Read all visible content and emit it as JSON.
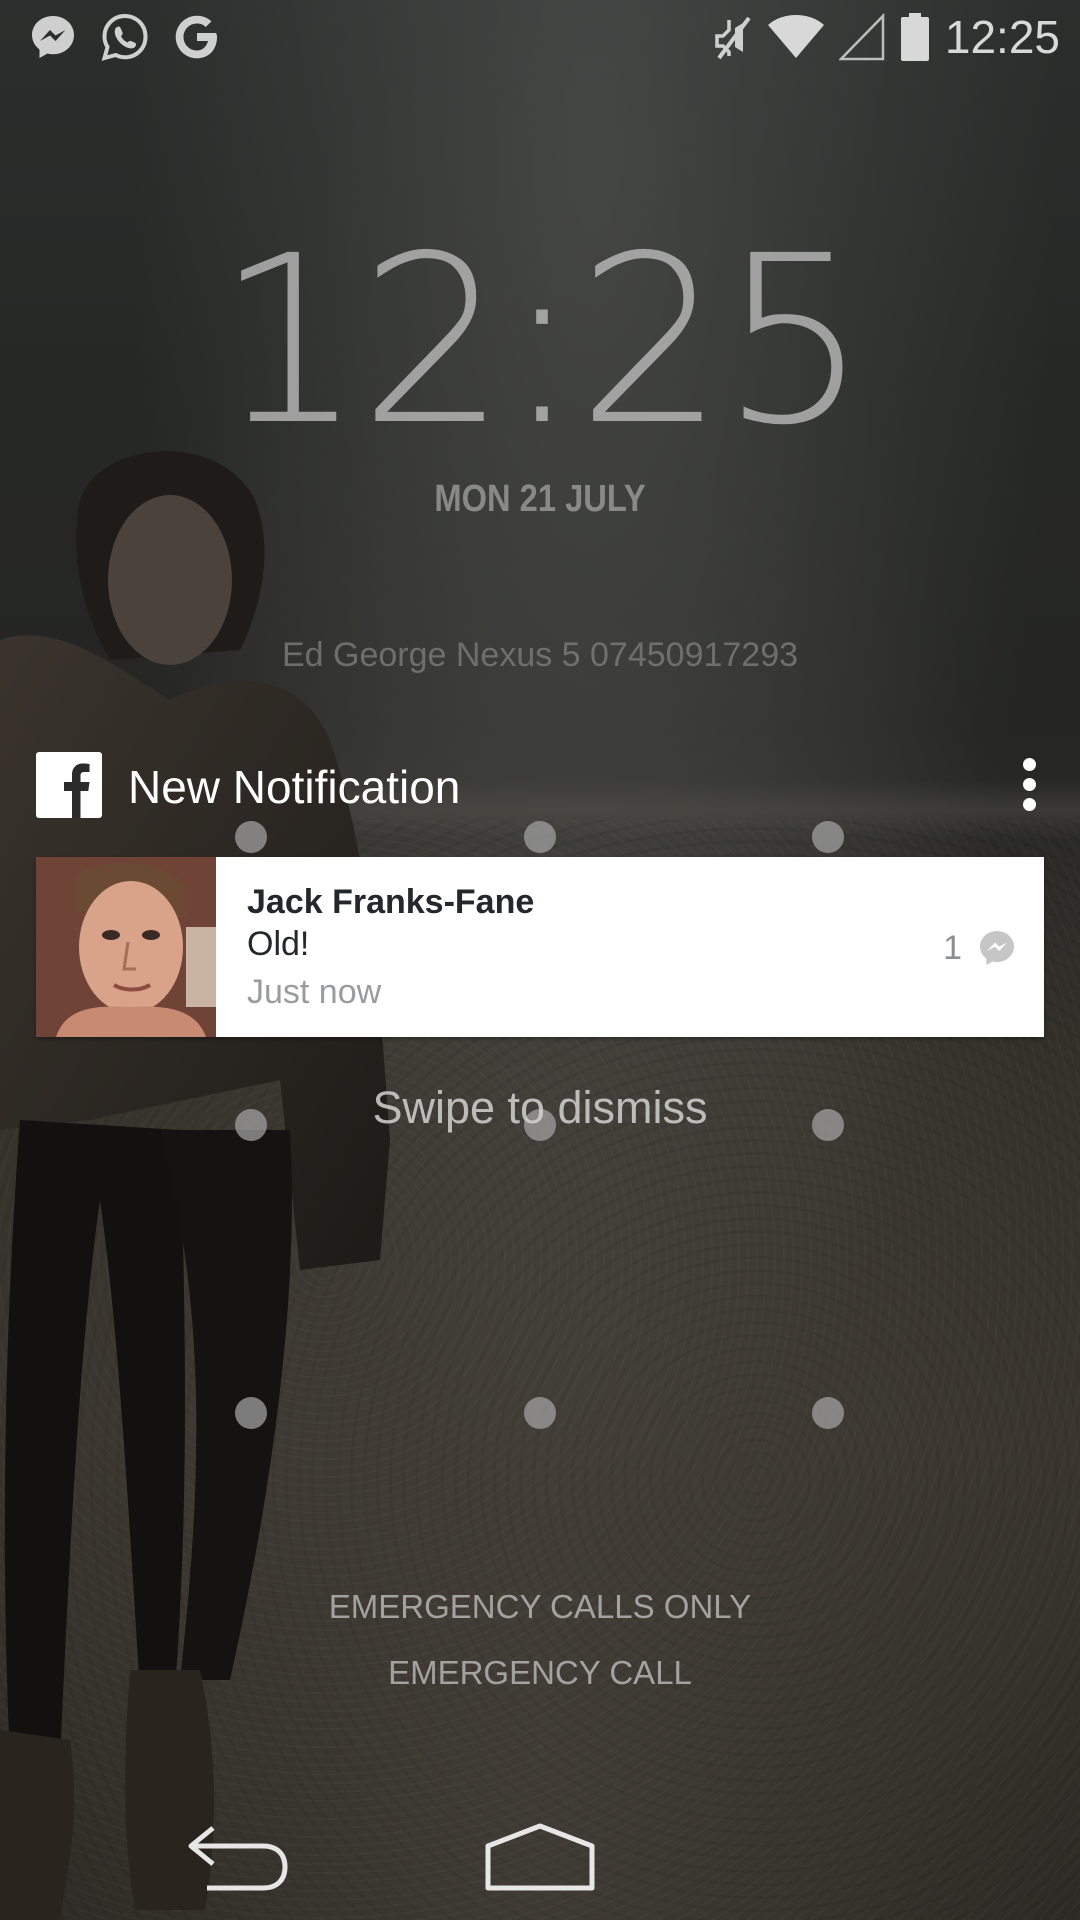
{
  "status_bar": {
    "notification_icons": [
      "messenger-icon",
      "whatsapp-icon",
      "google-icon"
    ],
    "system_icons": [
      "vibrate-mute-icon",
      "wifi-icon",
      "cell-signal-icon",
      "battery-icon"
    ],
    "time": "12:25"
  },
  "lockscreen": {
    "clock": "12:25",
    "date": "MON 21 JULY",
    "owner_info": "Ed George Nexus 5 07450917293"
  },
  "notification": {
    "app_icon": "facebook-icon",
    "header_title": "New Notification",
    "sender": "Jack Franks-Fane",
    "message": "Old!",
    "time_ago": "Just now",
    "count": "1",
    "source_icon": "messenger-icon"
  },
  "swipe_hint": "Swipe to dismiss",
  "emergency": {
    "status": "EMERGENCY CALLS ONLY",
    "call_button": "EMERGENCY CALL"
  },
  "navigation": {
    "buttons": [
      "back-icon",
      "home-icon"
    ]
  },
  "colors": {
    "card_background": "#ffffff",
    "text_dark": "#24272b",
    "text_muted": "#9a9b9c"
  }
}
